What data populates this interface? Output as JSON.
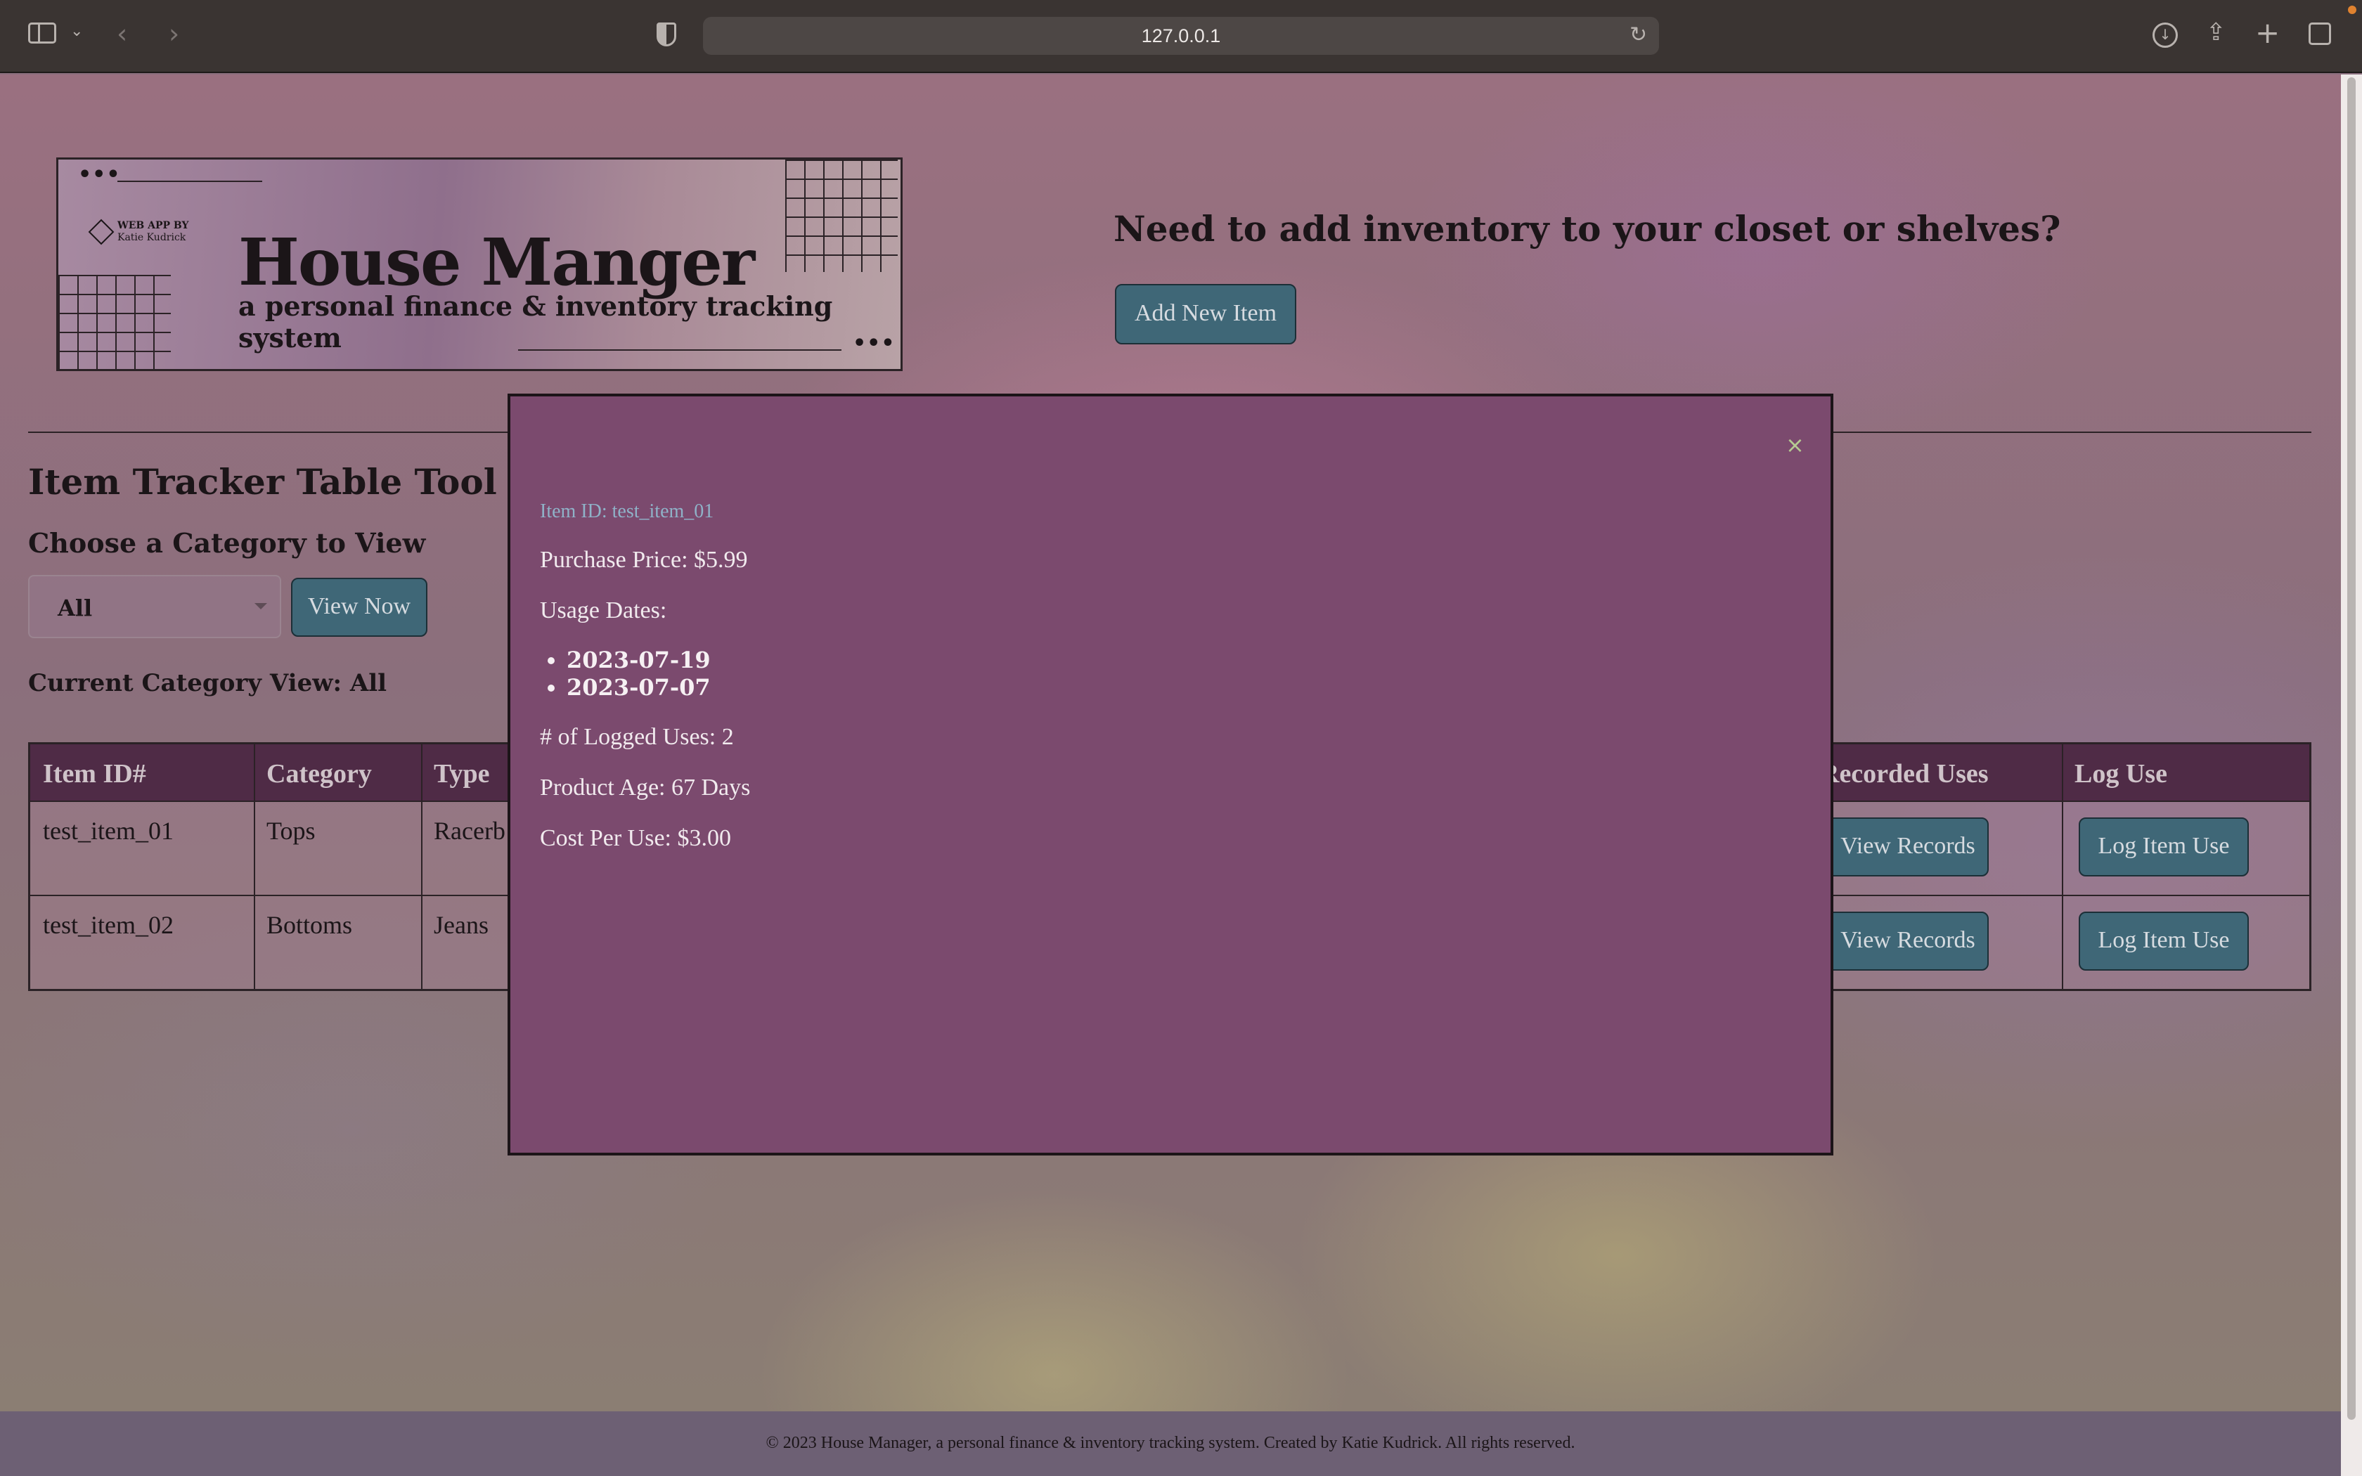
{
  "browser": {
    "url": "127.0.0.1"
  },
  "banner": {
    "credit_line1": "WEB APP BY",
    "credit_line2": "Katie Kudrick",
    "title": "House Manger",
    "subtitle": "a personal finance & inventory tracking system"
  },
  "cta": {
    "heading": "Need to add inventory to your closet or shelves?",
    "add_button": "Add New Item"
  },
  "tracker": {
    "title": "Item Tracker Table Tool",
    "choose_label": "Choose a Category to View",
    "category_selected": "All",
    "view_button": "View Now",
    "current_view": "Current Category View: All"
  },
  "table": {
    "headers": {
      "item_id": "Item ID#",
      "category": "Category",
      "type": "Type",
      "recorded_uses": "Recorded Uses",
      "log_use": "Log Use"
    },
    "rows": [
      {
        "item_id": "test_item_01",
        "category": "Tops",
        "type": "Racerb",
        "view_records": "View Records",
        "log_item_use": "Log Item Use"
      },
      {
        "item_id": "test_item_02",
        "category": "Bottoms",
        "type": "Jeans",
        "view_records": "View Records",
        "log_item_use": "Log Item Use"
      }
    ]
  },
  "modal": {
    "close": "×",
    "item_id": "Item ID: test_item_01",
    "purchase_price": "Purchase Price: $5.99",
    "usage_dates_label": "Usage Dates:",
    "usage_dates": [
      "2023-07-19",
      "2023-07-07"
    ],
    "logged_uses": "# of Logged Uses: 2",
    "product_age": "Product Age: 67 Days",
    "cost_per_use": "Cost Per Use: $3.00"
  },
  "footer": {
    "text": "© 2023 House Manager, a personal finance & inventory tracking system. Created by Katie Kudrick. All rights reserved."
  },
  "colors": {
    "button_bg": "#3f6777",
    "table_header_bg": "#4f2b46",
    "modal_bg": "#7b4a6e",
    "modal_id_text": "#8fb2c8"
  }
}
